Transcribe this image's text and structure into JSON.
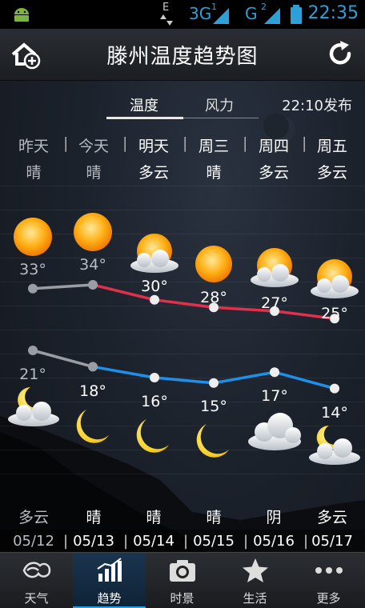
{
  "status_bar": {
    "network_e": "E",
    "sim1_label": "3G",
    "sim1_index": "1",
    "sim2_label": "G",
    "sim2_index": "2",
    "time": "22:35"
  },
  "header": {
    "title": "滕州温度趋势图"
  },
  "tabs": [
    {
      "label": "温度",
      "active": true
    },
    {
      "label": "风力",
      "active": false
    }
  ],
  "publish_time": "22:10发布",
  "days": [
    {
      "name": "昨天",
      "day_condition": "晴",
      "high": "33°",
      "low": "21°",
      "night_condition": "多云",
      "date": "05/12",
      "past": true,
      "day_icon": "sun-icon",
      "night_icon": "moon-cloud-icon"
    },
    {
      "name": "今天",
      "day_condition": "晴",
      "high": "34°",
      "low": "18°",
      "night_condition": "晴",
      "date": "05/13",
      "past": true,
      "day_icon": "sun-icon",
      "night_icon": "moon-icon"
    },
    {
      "name": "明天",
      "day_condition": "多云",
      "high": "30°",
      "low": "16°",
      "night_condition": "晴",
      "date": "05/14",
      "past": false,
      "day_icon": "sun-cloud-icon",
      "night_icon": "moon-icon"
    },
    {
      "name": "周三",
      "day_condition": "晴",
      "high": "28°",
      "low": "15°",
      "night_condition": "晴",
      "date": "05/15",
      "past": false,
      "day_icon": "sun-icon",
      "night_icon": "moon-icon"
    },
    {
      "name": "周四",
      "day_condition": "多云",
      "high": "27°",
      "low": "17°",
      "night_condition": "阴",
      "date": "05/16",
      "past": false,
      "day_icon": "sun-cloud-icon",
      "night_icon": "cloud-icon"
    },
    {
      "name": "周五",
      "day_condition": "多云",
      "high": "25°",
      "low": "14°",
      "night_condition": "多云",
      "date": "05/17",
      "past": false,
      "day_icon": "sun-cloud-icon",
      "night_icon": "moon-cloud-icon"
    }
  ],
  "chart_data": {
    "type": "line",
    "categories": [
      "05/12",
      "05/13",
      "05/14",
      "05/15",
      "05/16",
      "05/17"
    ],
    "series": [
      {
        "values": [
          33,
          34,
          30,
          28,
          27,
          25
        ],
        "color_past": "#9a9ea4",
        "color": "#e0304a"
      },
      {
        "values": [
          21,
          18,
          16,
          15,
          17,
          14
        ],
        "color_past": "#9a9ea4",
        "color": "#1e90e8"
      }
    ]
  },
  "bottom_nav": [
    {
      "label": "天气",
      "icon": "weather-icon",
      "active": false
    },
    {
      "label": "趋势",
      "icon": "trend-chart-icon",
      "active": true
    },
    {
      "label": "时景",
      "icon": "camera-icon",
      "active": false
    },
    {
      "label": "生活",
      "icon": "star-icon",
      "active": false
    },
    {
      "label": "更多",
      "icon": "more-dots-icon",
      "active": false
    }
  ],
  "colors": {
    "accent": "#2ea0d8",
    "high_line": "#e0304a",
    "low_line": "#1e90e8"
  }
}
